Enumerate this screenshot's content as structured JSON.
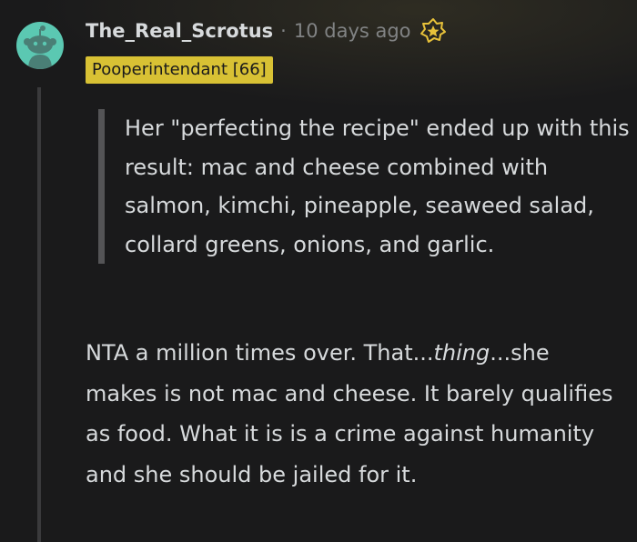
{
  "comment": {
    "username": "The_Real_Scrotus",
    "separator": "·",
    "timestamp": "10 days ago",
    "flair": "Pooperintendant [66]",
    "award_icon": "award-icon",
    "avatar_icon": "snoo-avatar-icon",
    "quote": "Her \"perfecting the recipe\" ended up with this result: mac and cheese combined with salmon, kimchi, pineapple, seaweed salad, collard greens, onions, and garlic.",
    "body": {
      "part1": "NTA a million times over. That...",
      "emphasis": "thing",
      "part2": "...she makes is not mac and cheese. It barely qualifies as food. What it is is a crime against humanity and she should be jailed for it."
    }
  },
  "colors": {
    "background": "#1a1a1b",
    "text": "#d7dadc",
    "meta": "#818384",
    "flair_bg": "#d8c134",
    "avatar_bg": "#5bc8b2",
    "award": "#e8c23a"
  }
}
